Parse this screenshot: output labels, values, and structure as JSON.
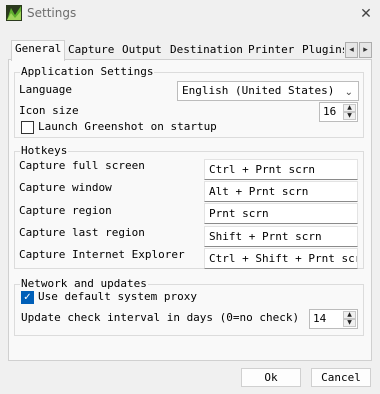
{
  "window": {
    "title": "Settings",
    "app_icon": "greenshot-icon",
    "close_glyph": "✕"
  },
  "tabs": [
    {
      "label": "General",
      "active": true
    },
    {
      "label": "Capture"
    },
    {
      "label": "Output"
    },
    {
      "label": "Destination"
    },
    {
      "label": "Printer"
    },
    {
      "label": "Plugins"
    }
  ],
  "tab_scroll": {
    "left": "◂",
    "right": "▸"
  },
  "application_settings": {
    "title": "Application Settings",
    "language_label": "Language",
    "language_value": "English (United States)",
    "icon_size_label": "Icon size",
    "icon_size_value": "16",
    "launch_label": "Launch Greenshot on startup",
    "launch_checked": false
  },
  "hotkeys": {
    "title": "Hotkeys",
    "items": [
      {
        "label": "Capture full screen",
        "value": "Ctrl + Prnt scrn"
      },
      {
        "label": "Capture window",
        "value": "Alt + Prnt scrn"
      },
      {
        "label": "Capture region",
        "value": "Prnt scrn"
      },
      {
        "label": "Capture last region",
        "value": "Shift + Prnt scrn"
      },
      {
        "label": "Capture Internet Explorer",
        "value": "Ctrl + Shift + Prnt scrn"
      }
    ]
  },
  "network": {
    "title": "Network and updates",
    "proxy_label": "Use default system proxy",
    "proxy_checked": true,
    "interval_label": "Update check interval in days (0=no check)",
    "interval_value": "14"
  },
  "buttons": {
    "ok": "Ok",
    "cancel": "Cancel"
  },
  "colors": {
    "checkbox_accent": "#005fb8",
    "window_bg": "#f0f0f0",
    "page_bg": "#f9f9f9"
  }
}
